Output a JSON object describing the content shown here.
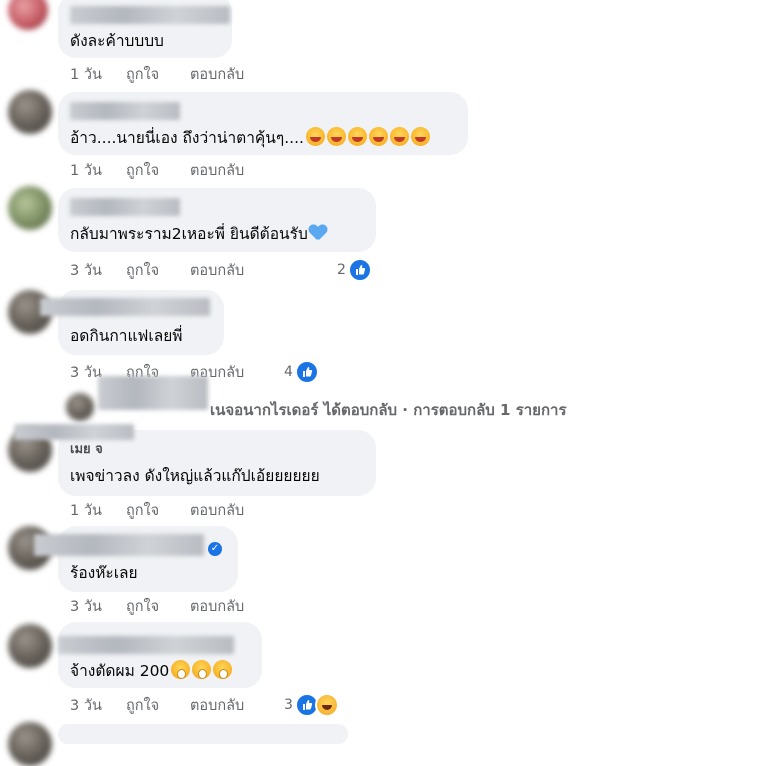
{
  "comments": [
    {
      "text": "ดังละค้าบบบบ",
      "time": "1 วัน"
    },
    {
      "text": "อ้าว....นายนี่เอง ถึงว่าน่าตาคุ้นๆ....",
      "time": "1 วัน"
    },
    {
      "text": "กลับมาพระราม2เหอะพี่ ยินดีต้อนรับ",
      "time": "3 วัน",
      "reactions": "2"
    },
    {
      "text": "อดกินกาแฟเลยพี่",
      "time": "3 วัน",
      "reactions": "4"
    },
    {
      "text": "เพจข่าวลง ดังใหญ่แล้วแก๊ปเอ้ยยยยยย",
      "time": "1 วัน"
    },
    {
      "text": "ร้องห๊ะเลย",
      "time": "3 วัน"
    },
    {
      "text": "จ้างตัดผม 200",
      "time": "3 วัน",
      "reactions": "3"
    }
  ],
  "actions": {
    "like": "ถูกใจ",
    "reply": "ตอบกลับ"
  },
  "reply_summary": {
    "text": "เนจอนากไรเดอร์ ได้ตอบกลับ · การตอบกลับ 1 รายการ"
  },
  "partial_name": {
    "text": "เมย จ"
  },
  "icons": {
    "like": "thumbs-up-icon",
    "laugh": "laugh-reaction-icon",
    "heart": "blue-heart-emoji",
    "grin": "squinting-tongue-emoji",
    "cold": "cold-face-emoji",
    "verified": "verified-badge-icon"
  },
  "colors": {
    "bubble": "#f0f2f5",
    "meta": "#65676b",
    "like_blue": "#1b74e4"
  }
}
